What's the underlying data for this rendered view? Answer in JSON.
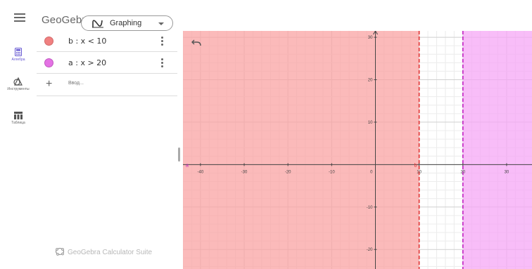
{
  "header": {
    "logo_text": "GeoGebra",
    "app_switcher_label": "Graphing"
  },
  "rail": {
    "items": [
      {
        "label": "Алгебра",
        "icon": "calculator-icon"
      },
      {
        "label": "Инструменты",
        "icon": "tools-icon"
      },
      {
        "label": "Таблица",
        "icon": "table-icon"
      }
    ]
  },
  "algebra": {
    "rows": [
      {
        "expr": "b : x < 10",
        "color": "#f08080"
      },
      {
        "expr": "a : x > 20",
        "color": "#e472e4"
      }
    ],
    "input_placeholder": "Ввод...",
    "suite_label": "GeoGebra Calculator Suite"
  },
  "graphics": {
    "x_ticks": [
      -40,
      -30,
      -20,
      -10,
      10,
      20,
      30
    ],
    "y_ticks": [
      -20,
      -10,
      10,
      20,
      30
    ],
    "origin_label": "0",
    "region_b_label": "b",
    "region_a_label": "a",
    "colors": {
      "region_b": "#f9a3a3",
      "region_a": "#f5a7f5",
      "line_b": "#e03030",
      "line_a": "#c020c0"
    },
    "view": {
      "xmin": -44.0,
      "xmax": 35.8,
      "ymin": -24.6,
      "ymax": 31.5
    }
  }
}
